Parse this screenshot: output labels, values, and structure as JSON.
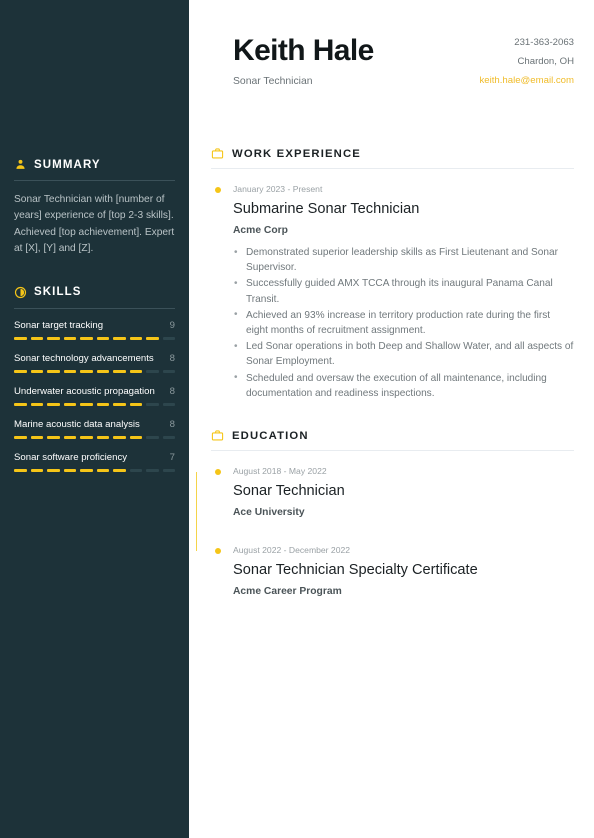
{
  "header": {
    "name": "Keith Hale",
    "role": "Sonar Technician",
    "contact": {
      "phone": "231-363-2063",
      "location": "Chardon, OH",
      "email": "keith.hale@email.com"
    }
  },
  "sidebar": {
    "summary": {
      "icon": "user-icon",
      "title": "SUMMARY",
      "text": "Sonar Technician with [number of years] experience of [top 2-3 skills]. Achieved [top achievement]. Expert at [X], [Y] and [Z]."
    },
    "skills": {
      "icon": "chart-circle-icon",
      "title": "SKILLS",
      "max": 10,
      "items": [
        {
          "name": "Sonar target tracking",
          "score": 9
        },
        {
          "name": "Sonar technology advancements",
          "score": 8
        },
        {
          "name": "Underwater acoustic propagation",
          "score": 8
        },
        {
          "name": "Marine acoustic data analysis",
          "score": 8
        },
        {
          "name": "Sonar software proficiency",
          "score": 7
        }
      ]
    }
  },
  "main": {
    "work": {
      "icon": "briefcase-icon",
      "title": "WORK EXPERIENCE",
      "entries": [
        {
          "date": "January 2023 - Present",
          "title": "Submarine Sonar Technician",
          "org": "Acme Corp",
          "bullets": [
            "Demonstrated superior leadership skills as First Lieutenant and Sonar Supervisor.",
            "Successfully guided AMX TCCA through its inaugural Panama Canal Transit.",
            "Achieved an 93% increase in territory production rate during the first eight months of recruitment assignment.",
            "Led Sonar operations in both Deep and Shallow Water, and all aspects of Sonar Employment.",
            "Scheduled and oversaw the execution of all maintenance, including documentation and readiness inspections."
          ]
        }
      ]
    },
    "education": {
      "icon": "briefcase-icon",
      "title": "EDUCATION",
      "entries": [
        {
          "date": "August 2018 - May 2022",
          "title": "Sonar Technician",
          "org": "Ace University"
        },
        {
          "date": "August 2022 - December 2022",
          "title": "Sonar Technician Specialty Certificate",
          "org": "Acme Career Program"
        }
      ]
    }
  },
  "colors": {
    "sidebar_bg": "#1d3239",
    "accent": "#f5c518",
    "email": "#f0bc2a"
  }
}
